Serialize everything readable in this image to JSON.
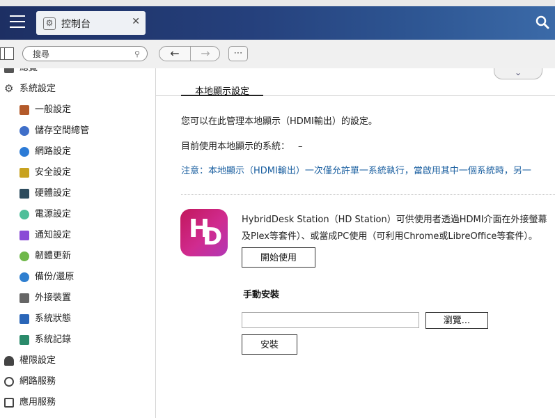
{
  "titlebar": {
    "tab_label": "控制台",
    "tab_icon": "gear-icon",
    "search_icon": "search-icon"
  },
  "toolbar": {
    "search_placeholder": "搜尋"
  },
  "sidebar": {
    "top_partial": "總覽",
    "system_settings": "系統設定",
    "items": [
      {
        "label": "一般設定",
        "icon": "general-settings-icon",
        "color": "#b35a2a"
      },
      {
        "label": "儲存空間總管",
        "icon": "storage-icon",
        "color": "#3f6fc9"
      },
      {
        "label": "網路設定",
        "icon": "network-icon",
        "color": "#2c7bd6"
      },
      {
        "label": "安全設定",
        "icon": "lock-icon",
        "color": "#c8a21f"
      },
      {
        "label": "硬體設定",
        "icon": "hardware-icon",
        "color": "#2d4c5e"
      },
      {
        "label": "電源設定",
        "icon": "power-bulb-icon",
        "color": "#4fbf9a"
      },
      {
        "label": "通知設定",
        "icon": "notification-icon",
        "color": "#8a4bd6"
      },
      {
        "label": "韌體更新",
        "icon": "firmware-update-icon",
        "color": "#6fb84a"
      },
      {
        "label": "備份/還原",
        "icon": "backup-restore-icon",
        "color": "#2f7fd0"
      },
      {
        "label": "外接裝置",
        "icon": "external-device-icon",
        "color": "#666666"
      },
      {
        "label": "系統狀態",
        "icon": "system-status-icon",
        "color": "#2a66b8"
      },
      {
        "label": "系統記錄",
        "icon": "system-log-icon",
        "color": "#2a8a6a"
      }
    ],
    "privilege": "權限設定",
    "network_services": "網路服務",
    "app_services": "應用服務"
  },
  "main": {
    "tab_label": "本地顯示設定",
    "intro": "您可以在此管理本地顯示（HDMI輸出）的設定。",
    "current_system_label": "目前使用本地顯示的系統：",
    "current_system_value": "–",
    "note": "注意：本地顯示（HDMI輸出）一次僅允許單一系統執行，當啟用其中一個系統時，另一",
    "hd_logo_h": "H",
    "hd_logo_d": "D",
    "hd_desc_line1": "HybridDesk Station（HD Station）可供使用者透過HDMI介面在外接螢幕",
    "hd_desc_line2": "及Plex等套件）、或當成PC使用（可利用Chrome或LibreOffice等套件）。",
    "start_button": "開始使用",
    "manual_install_title": "手動安裝",
    "browse_button": "瀏覽...",
    "install_button": "安裝"
  }
}
